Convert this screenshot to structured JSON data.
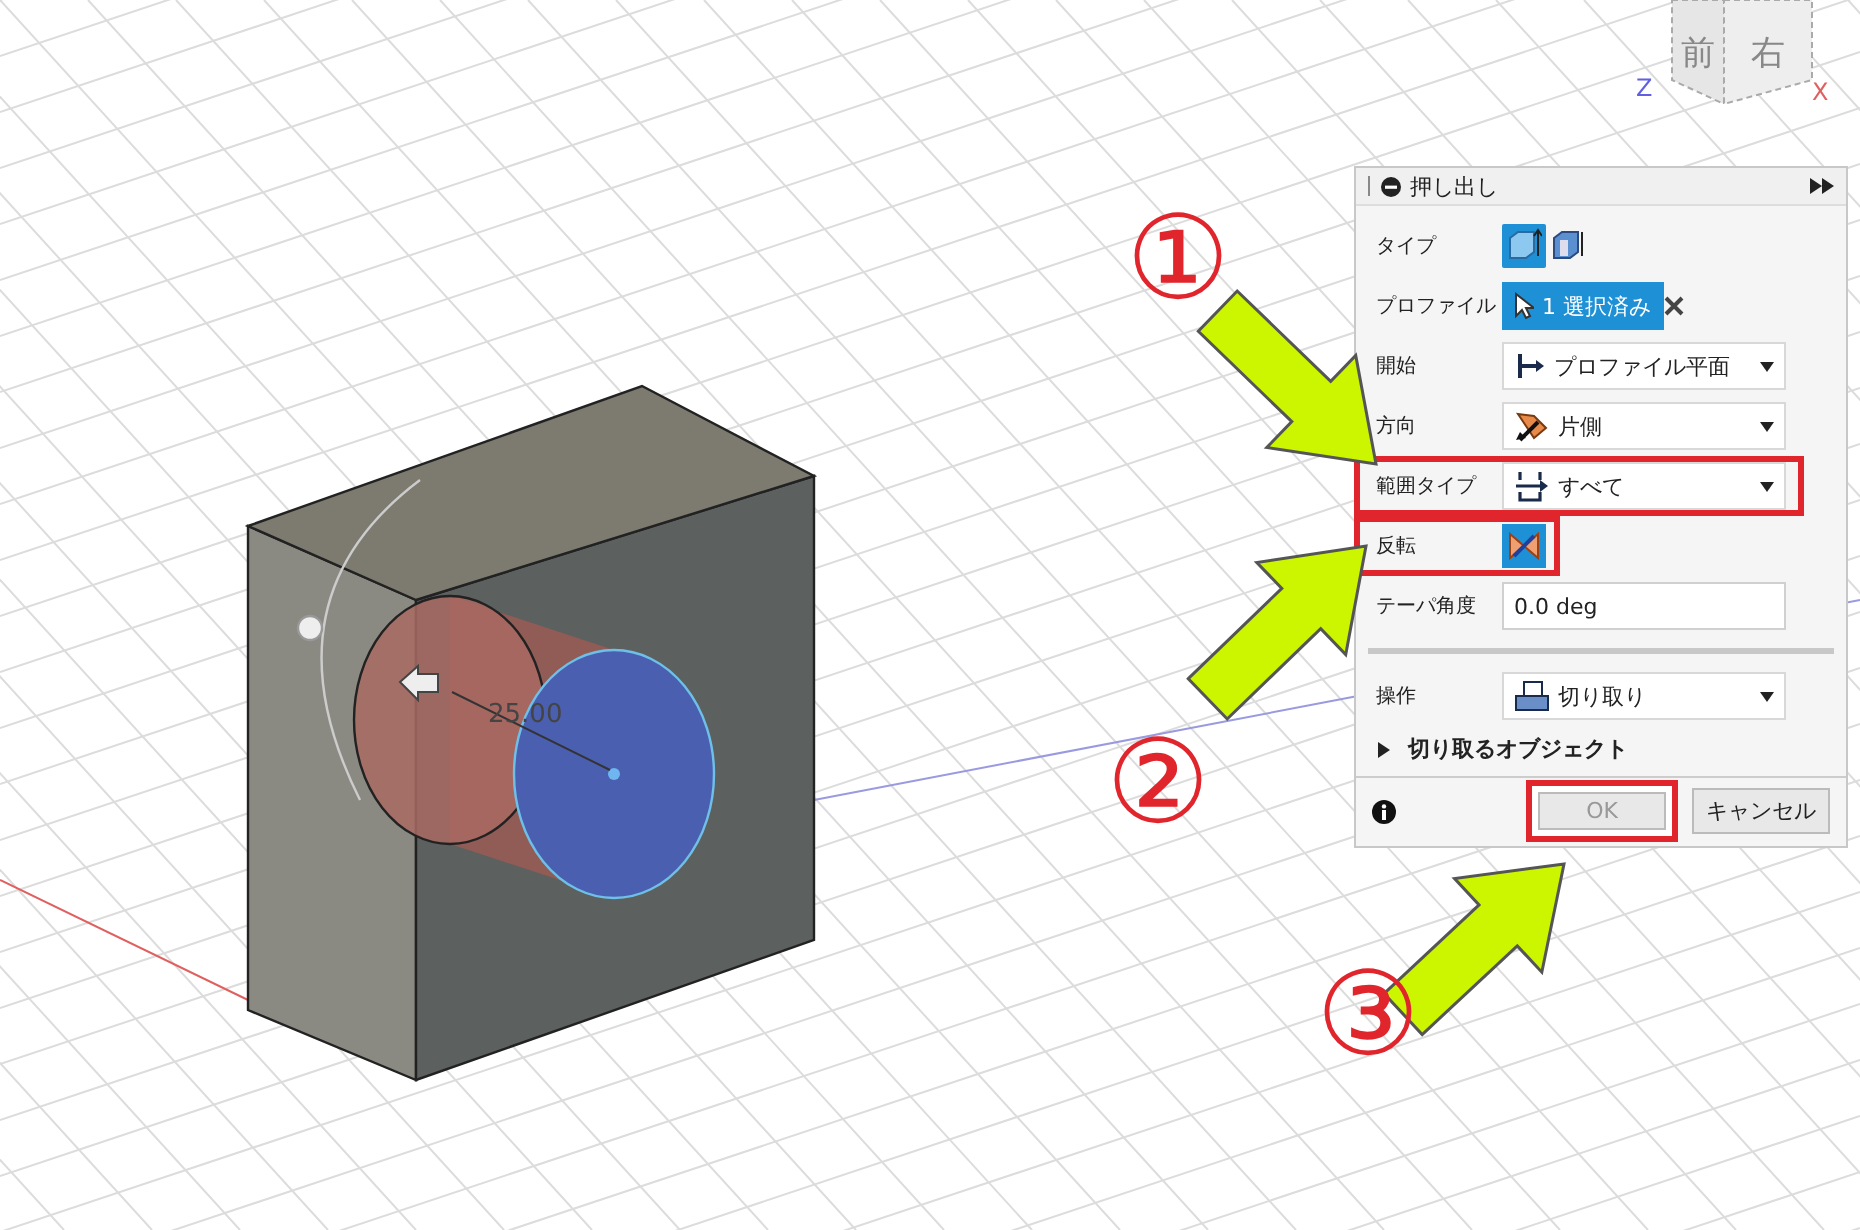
{
  "viewport": {
    "dimension": "25.00",
    "view_cube": {
      "faces": [
        "前",
        "右"
      ],
      "axes": [
        "Z",
        "X"
      ]
    }
  },
  "dialog": {
    "title": "押し出し",
    "rows": [
      {
        "kind": "type",
        "label": "タイプ",
        "options": [
          {
            "selected": true
          },
          {
            "selected": false
          }
        ]
      },
      {
        "kind": "selection",
        "label": "プロファイル",
        "value": "1 選択済み"
      },
      {
        "kind": "dropdown",
        "label": "開始",
        "value": "プロファイル平面"
      },
      {
        "kind": "dropdown",
        "label": "方向",
        "value": "片側"
      },
      {
        "kind": "dropdown",
        "label": "範囲タイプ",
        "value": "すべて",
        "highlighted": true
      },
      {
        "kind": "toggle",
        "label": "反転",
        "on": true,
        "highlighted": true
      },
      {
        "kind": "input",
        "label": "テーパ角度",
        "value": "0.0 deg"
      },
      {
        "kind": "divider"
      },
      {
        "kind": "dropdown",
        "label": "操作",
        "value": "切り取り"
      },
      {
        "kind": "section",
        "label": "切り取るオブジェクト",
        "expanded": false
      }
    ],
    "buttons": [
      {
        "label": "OK",
        "disabled": true,
        "highlighted": true
      },
      {
        "label": "キャンセル",
        "disabled": false
      }
    ]
  },
  "annotations": [
    {
      "marker": "①"
    },
    {
      "marker": "②"
    },
    {
      "marker": "③"
    }
  ]
}
